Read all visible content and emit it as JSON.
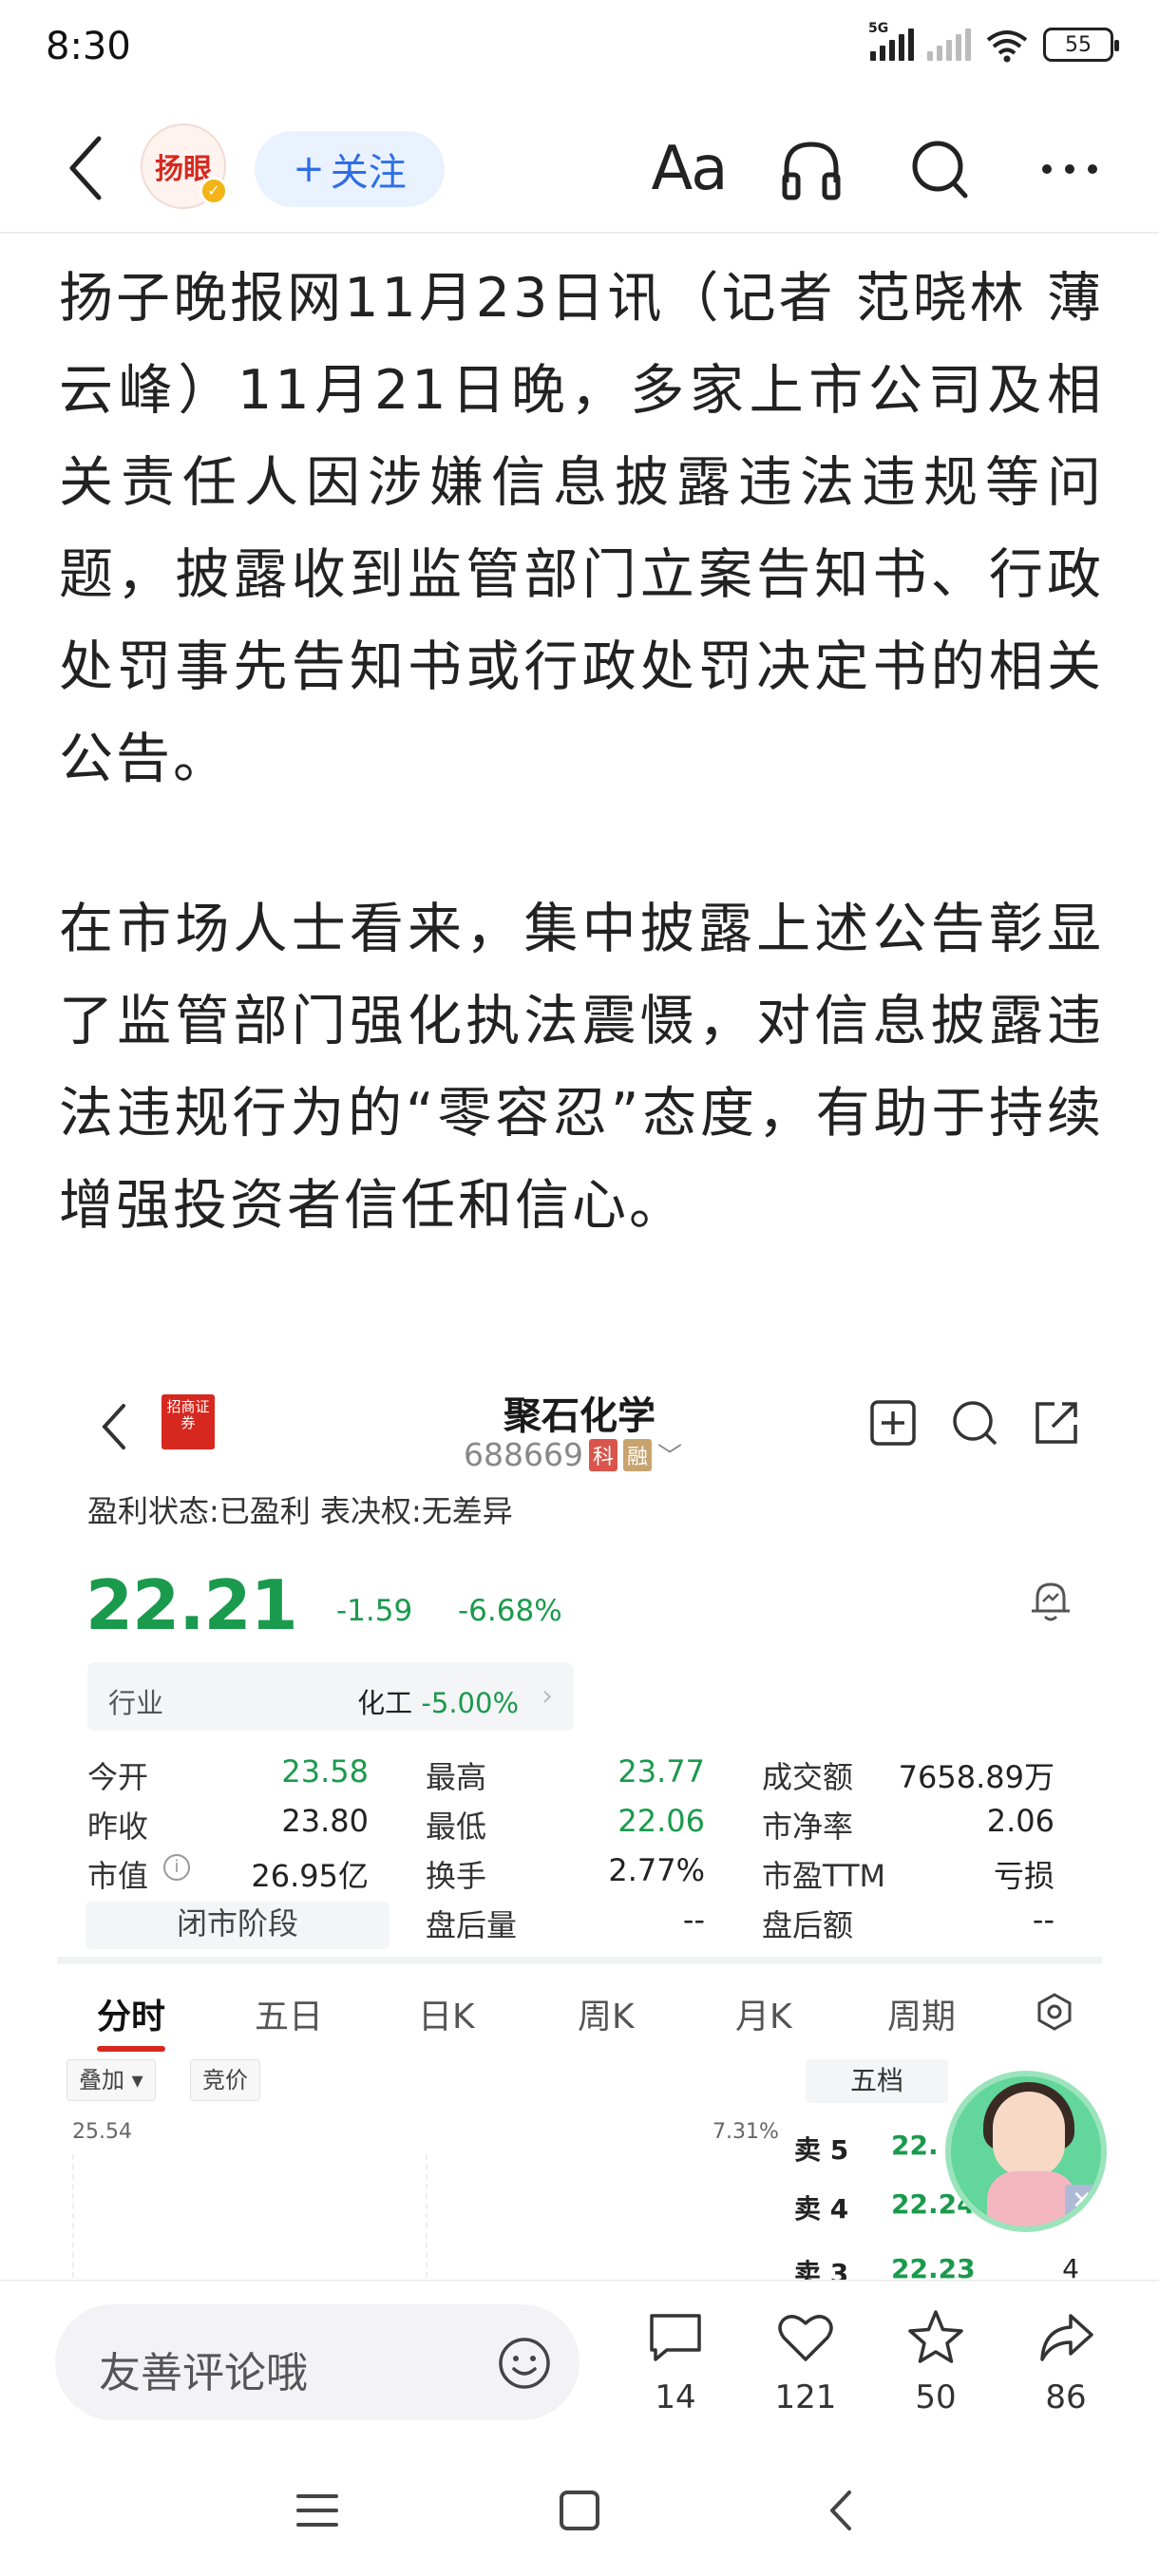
{
  "status_bar": {
    "time": "8:30",
    "network": "5G",
    "battery": "55"
  },
  "nav": {
    "avatar_text": "扬眼",
    "follow_label": "关注",
    "follow_plus": "+",
    "font_label": "Aa"
  },
  "article": {
    "paragraphs": [
      "扬子晚报网11月23日讯（记者 范晓林 薄云峰）11月21日晚，多家上市公司及相关责任人因涉嫌信息披露违法违规等问题，披露收到监管部门立案告知书、行政处罚事先告知书或行政处罚决定书的相关公告。",
      "在市场人士看来，集中披露上述公告彰显了监管部门强化执法震慑，对信息披露违法违规行为的“零容忍”态度，有助于持续增强投资者信任和信心。"
    ]
  },
  "stock_image": {
    "broker_logo": "招商证券",
    "name": "聚石化学",
    "code": "688669",
    "tag_ke": "科",
    "tag_rong": "融",
    "status_line": "盈利状态:已盈利  表决权:无差异",
    "price": "22.21",
    "change": "-1.59",
    "change_pct": "-6.68%",
    "industry_label": "行业",
    "industry_name": "化工",
    "industry_pct": "-5.00%",
    "stats": {
      "open_label": "今开",
      "open": "23.58",
      "high_label": "最高",
      "high": "23.77",
      "turnover_amt_label": "成交额",
      "turnover_amt": "7658.89万",
      "prev_close_label": "昨收",
      "prev_close": "23.80",
      "low_label": "最低",
      "low": "22.06",
      "pb_label": "市净率",
      "pb": "2.06",
      "mcap_label": "市值",
      "mcap": "26.95亿",
      "turnover_rate_label": "换手",
      "turnover_rate": "2.77%",
      "pe_label": "市盈TTM",
      "pe": "亏损",
      "closed_phase": "闭市阶段",
      "after_vol_label": "盘后量",
      "after_vol": "--",
      "after_amt_label": "盘后额",
      "after_amt": "--"
    },
    "tabs": [
      "分时",
      "五日",
      "日K",
      "周K",
      "月K",
      "周期"
    ],
    "chips": [
      "叠加 ▾",
      "竞价"
    ],
    "chart_max": "25.54",
    "chart_max_pct": "7.31%",
    "orderbook_title": "五档",
    "orderbook": [
      {
        "label": "卖 5",
        "price": "22.",
        "vol": ""
      },
      {
        "label": "卖 4",
        "price": "22.24",
        "vol": ""
      },
      {
        "label": "卖 3",
        "price": "22.23",
        "vol": "4"
      }
    ]
  },
  "bottom_bar": {
    "comment_placeholder": "友善评论哦",
    "comments": "14",
    "likes": "121",
    "favorites": "50",
    "shares": "86"
  }
}
